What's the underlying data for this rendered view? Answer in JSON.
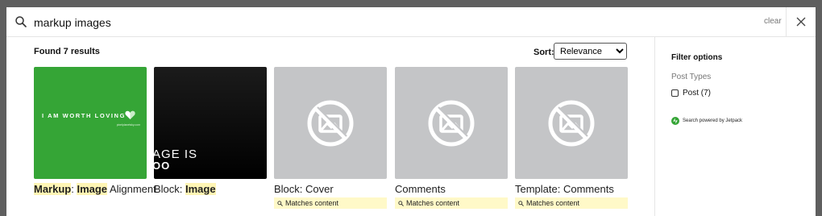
{
  "search": {
    "query": "markup images",
    "clear_label": "clear"
  },
  "results": {
    "found_label": "Found 7 results",
    "sort_label": "Sort:",
    "sort_selected": "Relevance",
    "items": [
      {
        "title_parts": [
          {
            "text": "Markup",
            "highlight": true
          },
          {
            "text": ": ",
            "highlight": false
          },
          {
            "text": "Image",
            "highlight": true
          },
          {
            "text": " Alignment",
            "highlight": false
          }
        ],
        "thumb": {
          "style": "green",
          "text": "I AM WORTH LOVING",
          "url": "pixelplanetsky.com"
        }
      },
      {
        "title_parts": [
          {
            "text": "Block: ",
            "highlight": false
          },
          {
            "text": "Image",
            "highlight": true
          }
        ],
        "thumb": {
          "style": "dark",
          "text1": "AGE IS",
          "text2": "OO"
        }
      },
      {
        "title_parts": [
          {
            "text": "Block: Cover",
            "highlight": false
          }
        ],
        "thumb": {
          "style": "placeholder"
        },
        "match_label": "Matches content"
      },
      {
        "title_parts": [
          {
            "text": "Comments",
            "highlight": false
          }
        ],
        "thumb": {
          "style": "placeholder"
        },
        "match_label": "Matches content"
      },
      {
        "title_parts": [
          {
            "text": "Template: Comments",
            "highlight": false
          }
        ],
        "thumb": {
          "style": "placeholder"
        },
        "match_label": "Matches content"
      }
    ]
  },
  "sidebar": {
    "title": "Filter options",
    "post_types_label": "Post Types",
    "post_checkbox_label": "Post (7)",
    "jetpack_label": "Search powered by Jetpack"
  },
  "colors": {
    "accent_green": "#35a536",
    "highlight": "#fff5b4",
    "placeholder_gray": "#c4c5c7",
    "overlay": "#5f5f5f"
  }
}
